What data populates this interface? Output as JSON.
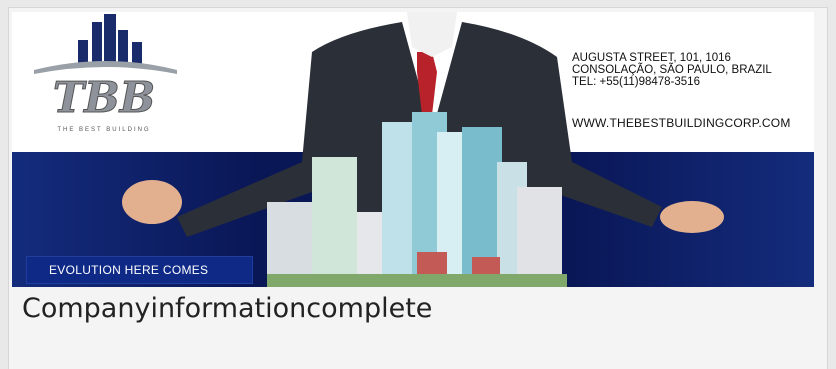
{
  "banner": {
    "logo": {
      "letters": "TBB",
      "tagline": "THE BEST BUILDING"
    },
    "address_lines": [
      "AUGUSTA STREET, 101, 1016",
      "CONSOLAÇÃO, SÃO PAULO, BRAZIL",
      "TEL: +55(11)98478-3516"
    ],
    "website": "WWW.THEBESTBUILDINGCORP.COM",
    "slogan": "EVOLUTION HERE COMES"
  },
  "caption": "Companyinformationcomplete"
}
